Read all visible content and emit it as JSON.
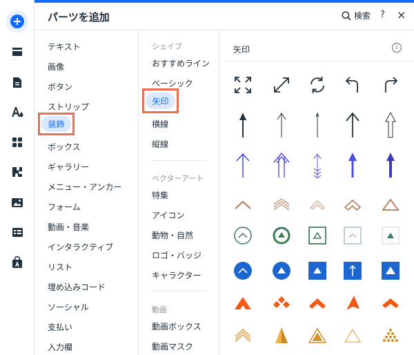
{
  "header": {
    "title": "パーツを追加",
    "search_label": "検索",
    "help_label": "?",
    "close_label": "×"
  },
  "rail": {
    "items": [
      {
        "name": "add-icon"
      },
      {
        "name": "layout-icon"
      },
      {
        "name": "page-icon"
      },
      {
        "name": "design-icon"
      },
      {
        "name": "apps-icon"
      },
      {
        "name": "plugin-icon"
      },
      {
        "name": "media-icon"
      },
      {
        "name": "table-icon"
      },
      {
        "name": "store-icon"
      }
    ]
  },
  "categories": {
    "items": [
      "テキスト",
      "画像",
      "ボタン",
      "ストリップ",
      "装飾",
      "ボックス",
      "ギャラリー",
      "メニュー・アンカー",
      "フォーム",
      "動画・音楽",
      "インタラクティブ",
      "リスト",
      "埋め込みコード",
      "ソーシャル",
      "支払い",
      "入力欄"
    ],
    "selected": "装飾"
  },
  "subcategories": {
    "shape_header": "シェイプ",
    "shape_items": [
      "おすすめライン",
      "ベーシック",
      "矢印",
      "横線",
      "縦線"
    ],
    "selected": "矢印",
    "vector_header": "ベクターアート",
    "vector_items": [
      "特集",
      "アイコン",
      "動物・自然",
      "ロゴ・バッジ",
      "キャラクター"
    ],
    "video_header": "動画",
    "video_items": [
      "動画ボックス",
      "動画マスク"
    ]
  },
  "gallery": {
    "title": "矢印",
    "info_label": "i",
    "colors": {
      "accent": "#116dff",
      "dark": "#20303c",
      "purple": "#4c4ed8",
      "copper": "#b87858",
      "green": "#3d7d55",
      "blue": "#1d66d1",
      "orange": "#f05a12",
      "gold": "#d6902a",
      "highlight": "#ef6c4f"
    }
  }
}
